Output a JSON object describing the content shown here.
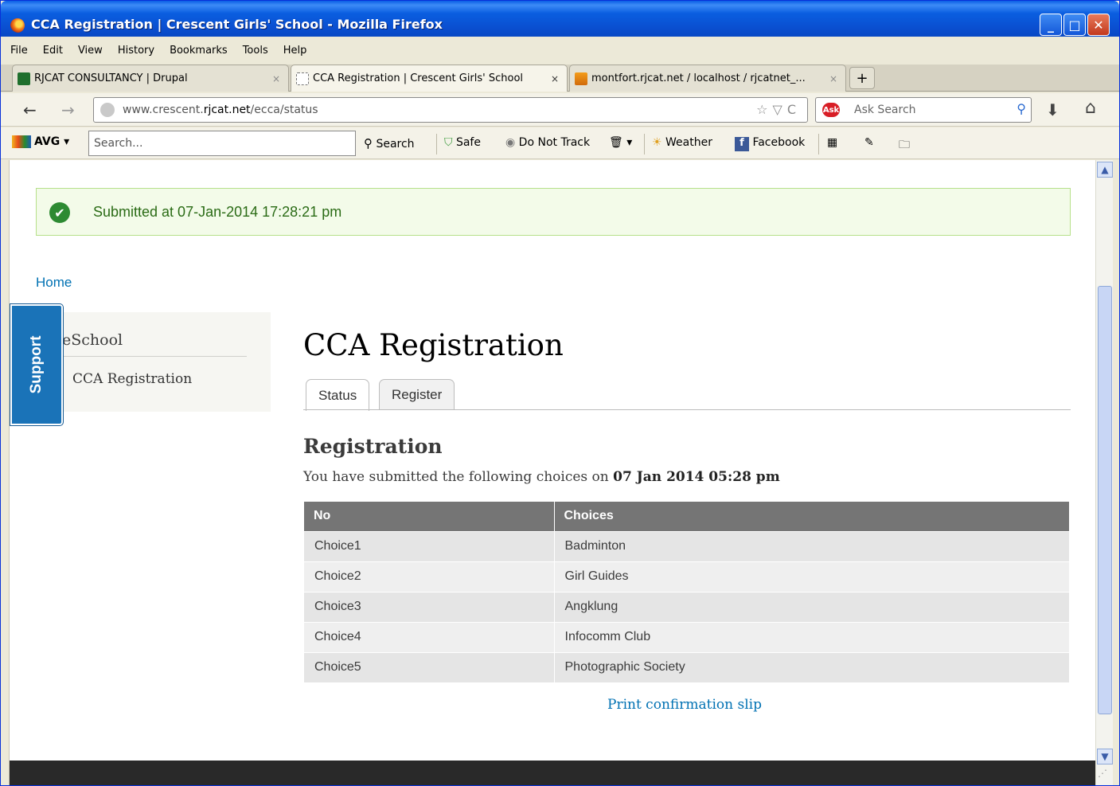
{
  "window": {
    "title": "CCA Registration | Crescent Girls' School - Mozilla Firefox",
    "minimize": "_",
    "maximize": "□",
    "close": "✕"
  },
  "menu": [
    "File",
    "Edit",
    "View",
    "History",
    "Bookmarks",
    "Tools",
    "Help"
  ],
  "tabs": [
    {
      "label": "RJCAT CONSULTANCY | Drupal",
      "close": "×"
    },
    {
      "label": "CCA Registration | Crescent Girls' School",
      "close": "×"
    },
    {
      "label": "montfort.rjcat.net / localhost / rjcatnet_...",
      "close": "×"
    }
  ],
  "new_tab": "+",
  "nav": {
    "back": "←",
    "forward": "→",
    "url_prefix": "www.crescent.",
    "url_host": "rjcat.net",
    "url_path": "/ecca/status",
    "url_icons": "☆▽C",
    "ask_search_placeholder": "Ask Search",
    "ask_logo": "Ask",
    "search_glyph": "⚲",
    "download_glyph": "⬇",
    "home_glyph": "⌂"
  },
  "avg_toolbar": {
    "brand": "AVG",
    "dropdown": "▾",
    "search_placeholder": "Search...",
    "search_button": "Search",
    "safe": "Safe",
    "do_not_track": "Do Not Track",
    "weather": "Weather",
    "facebook": "Facebook"
  },
  "page": {
    "status_message": "Submitted at 07-Jan-2014 17:28:21 pm",
    "status_check": "✔",
    "breadcrumb": "Home",
    "sidebar": {
      "title": "eSchool",
      "link": "CCA Registration"
    },
    "support_label": "Support",
    "title": "CCA Registration",
    "tabs": [
      "Status",
      "Register"
    ],
    "section_title": "Registration",
    "submitted_prefix": "You have submitted the following choices on ",
    "submitted_date": "07 Jan 2014 05:28 pm",
    "table": {
      "headers": [
        "No",
        "Choices"
      ],
      "rows": [
        [
          "Choice1",
          "Badminton"
        ],
        [
          "Choice2",
          "Girl Guides"
        ],
        [
          "Choice3",
          "Angklung"
        ],
        [
          "Choice4",
          "Infocomm Club"
        ],
        [
          "Choice5",
          "Photographic Society"
        ]
      ]
    },
    "print_link": "Print confirmation slip"
  },
  "scrollbar": {
    "up": "▲",
    "down": "▼"
  },
  "resize_grip": "⋰"
}
